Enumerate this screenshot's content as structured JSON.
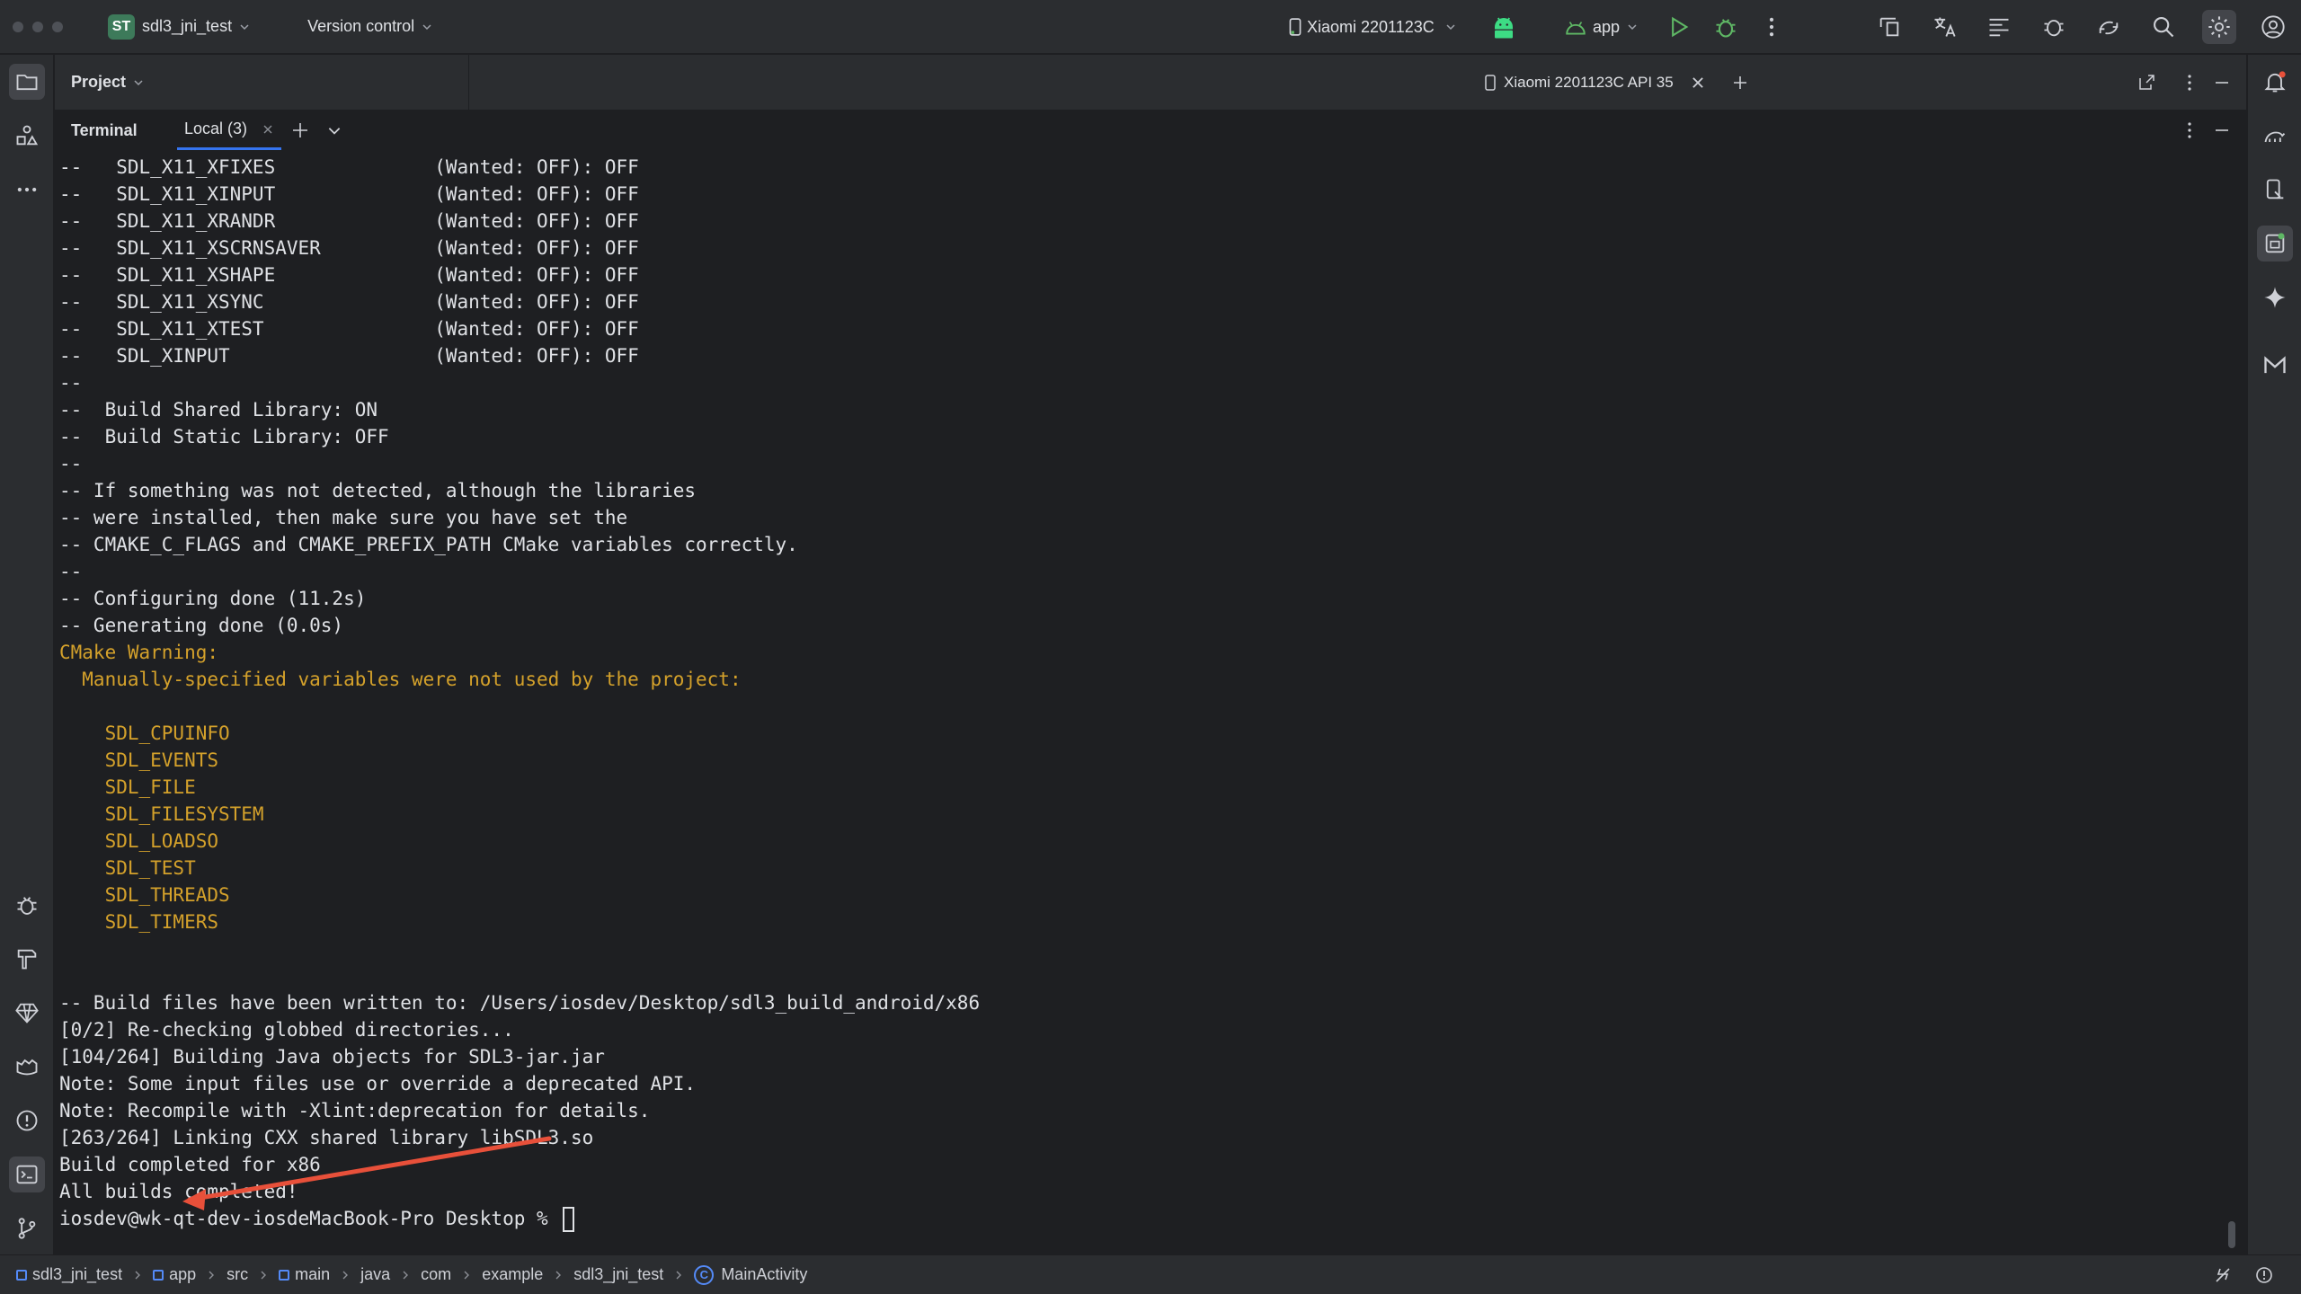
{
  "titlebar": {
    "project_initials": "ST",
    "project_name": "sdl3_jni_test",
    "version_control": "Version control",
    "device": "Xiaomi 2201123C",
    "run_config": "app"
  },
  "project_panel": {
    "title": "Project"
  },
  "editor": {
    "tab_label": "Xiaomi 2201123C API 35"
  },
  "terminal": {
    "title": "Terminal",
    "tab_label": "Local (3)",
    "lines": [
      {
        "text": "--   SDL_X11_XFIXES              (Wanted: OFF): OFF",
        "warn": false
      },
      {
        "text": "--   SDL_X11_XINPUT              (Wanted: OFF): OFF",
        "warn": false
      },
      {
        "text": "--   SDL_X11_XRANDR              (Wanted: OFF): OFF",
        "warn": false
      },
      {
        "text": "--   SDL_X11_XSCRNSAVER          (Wanted: OFF): OFF",
        "warn": false
      },
      {
        "text": "--   SDL_X11_XSHAPE              (Wanted: OFF): OFF",
        "warn": false
      },
      {
        "text": "--   SDL_X11_XSYNC               (Wanted: OFF): OFF",
        "warn": false
      },
      {
        "text": "--   SDL_X11_XTEST               (Wanted: OFF): OFF",
        "warn": false
      },
      {
        "text": "--   SDL_XINPUT                  (Wanted: OFF): OFF",
        "warn": false
      },
      {
        "text": "--",
        "warn": false
      },
      {
        "text": "--  Build Shared Library: ON",
        "warn": false
      },
      {
        "text": "--  Build Static Library: OFF",
        "warn": false
      },
      {
        "text": "--",
        "warn": false
      },
      {
        "text": "-- If something was not detected, although the libraries",
        "warn": false
      },
      {
        "text": "-- were installed, then make sure you have set the",
        "warn": false
      },
      {
        "text": "-- CMAKE_C_FLAGS and CMAKE_PREFIX_PATH CMake variables correctly.",
        "warn": false
      },
      {
        "text": "--",
        "warn": false
      },
      {
        "text": "-- Configuring done (11.2s)",
        "warn": false
      },
      {
        "text": "-- Generating done (0.0s)",
        "warn": false
      },
      {
        "text": "CMake Warning:",
        "warn": true
      },
      {
        "text": "  Manually-specified variables were not used by the project:",
        "warn": true
      },
      {
        "text": "",
        "warn": false
      },
      {
        "text": "    SDL_CPUINFO",
        "warn": true
      },
      {
        "text": "    SDL_EVENTS",
        "warn": true
      },
      {
        "text": "    SDL_FILE",
        "warn": true
      },
      {
        "text": "    SDL_FILESYSTEM",
        "warn": true
      },
      {
        "text": "    SDL_LOADSO",
        "warn": true
      },
      {
        "text": "    SDL_TEST",
        "warn": true
      },
      {
        "text": "    SDL_THREADS",
        "warn": true
      },
      {
        "text": "    SDL_TIMERS",
        "warn": true
      },
      {
        "text": "",
        "warn": false
      },
      {
        "text": "",
        "warn": false
      },
      {
        "text": "-- Build files have been written to: /Users/iosdev/Desktop/sdl3_build_android/x86",
        "warn": false
      },
      {
        "text": "[0/2] Re-checking globbed directories...",
        "warn": false
      },
      {
        "text": "[104/264] Building Java objects for SDL3-jar.jar",
        "warn": false
      },
      {
        "text": "Note: Some input files use or override a deprecated API.",
        "warn": false
      },
      {
        "text": "Note: Recompile with -Xlint:deprecation for details.",
        "warn": false
      },
      {
        "text": "[263/264] Linking CXX shared library libSDL3.so",
        "warn": false
      },
      {
        "text": "Build completed for x86",
        "warn": false
      },
      {
        "text": "All builds completed!",
        "warn": false
      }
    ],
    "prompt": "iosdev@wk-qt-dev-iosdeMacBook-Pro Desktop % "
  },
  "breadcrumbs": [
    {
      "label": "sdl3_jni_test",
      "icon": "module-icon"
    },
    {
      "label": "app",
      "icon": "module-icon"
    },
    {
      "label": "src",
      "icon": ""
    },
    {
      "label": "main",
      "icon": "module-icon"
    },
    {
      "label": "java",
      "icon": ""
    },
    {
      "label": "com",
      "icon": ""
    },
    {
      "label": "example",
      "icon": ""
    },
    {
      "label": "sdl3_jni_test",
      "icon": ""
    },
    {
      "label": "MainActivity",
      "icon": "class-icon"
    }
  ],
  "colors": {
    "background": "#1e1f22",
    "panel": "#2b2d30",
    "text": "#dfe1e5",
    "warning": "#d4a12b",
    "annotation_arrow": "#e8503a",
    "android_green": "#3ddc84",
    "run_green": "#5fb865",
    "accent": "#3574f0"
  }
}
